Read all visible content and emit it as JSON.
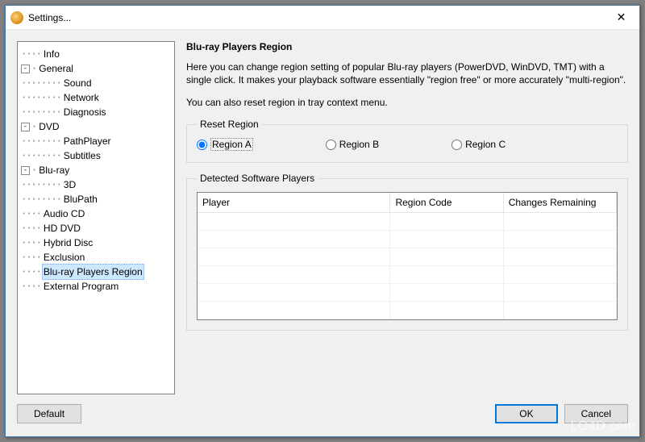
{
  "window": {
    "title": "Settings..."
  },
  "tree": {
    "items": [
      {
        "label": "Info",
        "depth": 0,
        "exp": null
      },
      {
        "label": "General",
        "depth": 0,
        "exp": "-"
      },
      {
        "label": "Sound",
        "depth": 1,
        "exp": null
      },
      {
        "label": "Network",
        "depth": 1,
        "exp": null
      },
      {
        "label": "Diagnosis",
        "depth": 1,
        "exp": null
      },
      {
        "label": "DVD",
        "depth": 0,
        "exp": "-"
      },
      {
        "label": "PathPlayer",
        "depth": 1,
        "exp": null
      },
      {
        "label": "Subtitles",
        "depth": 1,
        "exp": null
      },
      {
        "label": "Blu-ray",
        "depth": 0,
        "exp": "-"
      },
      {
        "label": "3D",
        "depth": 1,
        "exp": null
      },
      {
        "label": "BluPath",
        "depth": 1,
        "exp": null
      },
      {
        "label": "Audio CD",
        "depth": 0,
        "exp": null
      },
      {
        "label": "HD DVD",
        "depth": 0,
        "exp": null
      },
      {
        "label": "Hybrid Disc",
        "depth": 0,
        "exp": null
      },
      {
        "label": "Exclusion",
        "depth": 0,
        "exp": null
      },
      {
        "label": "Blu-ray Players Region",
        "depth": 0,
        "exp": null,
        "selected": true
      },
      {
        "label": "External Program",
        "depth": 0,
        "exp": null
      }
    ]
  },
  "page": {
    "heading": "Blu-ray Players Region",
    "para1": "Here you can change region setting of popular Blu-ray players (PowerDVD, WinDVD, TMT) with a single click. It makes your playback software essentially \"region free\" or more accurately \"multi-region\".",
    "para2": "You can also reset region in tray context menu.",
    "reset_legend": "Reset Region",
    "radios": [
      {
        "label": "Region A",
        "checked": true
      },
      {
        "label": "Region B",
        "checked": false
      },
      {
        "label": "Region C",
        "checked": false
      }
    ],
    "detect_legend": "Detected Software Players",
    "columns": [
      "Player",
      "Region Code",
      "Changes Remaining"
    ],
    "rows": [
      [
        "",
        "",
        ""
      ],
      [
        "",
        "",
        ""
      ],
      [
        "",
        "",
        ""
      ],
      [
        "",
        "",
        ""
      ],
      [
        "",
        "",
        ""
      ],
      [
        "",
        "",
        ""
      ]
    ]
  },
  "buttons": {
    "default": "Default",
    "ok": "OK",
    "cancel": "Cancel"
  },
  "watermark": "LO4D.com"
}
